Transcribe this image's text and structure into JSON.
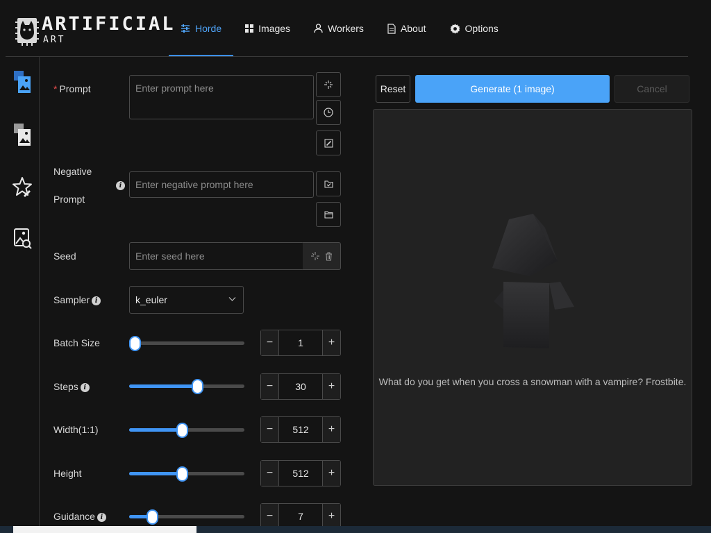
{
  "app": {
    "logo_title": "ARTIFICIAL",
    "logo_subtitle": "ART"
  },
  "nav": {
    "tabs": [
      {
        "label": "Horde",
        "icon": "sliders-icon",
        "active": true
      },
      {
        "label": "Images",
        "icon": "grid-icon",
        "active": false
      },
      {
        "label": "Workers",
        "icon": "user-icon",
        "active": false
      },
      {
        "label": "About",
        "icon": "document-icon",
        "active": false
      },
      {
        "label": "Options",
        "icon": "gear-icon",
        "active": false
      }
    ]
  },
  "sidebar": {
    "items": [
      {
        "name": "text-to-image-icon",
        "active": true
      },
      {
        "name": "image-to-image-icon",
        "active": false
      },
      {
        "name": "rating-star-icon",
        "active": false
      },
      {
        "name": "interrogate-icon",
        "active": false
      }
    ]
  },
  "form": {
    "prompt": {
      "label": "Prompt",
      "required_mark": "*",
      "placeholder": "Enter prompt here",
      "value": ""
    },
    "negative_prompt": {
      "label_line1": "Negative",
      "label_line2": "Prompt",
      "placeholder": "Enter negative prompt here",
      "value": ""
    },
    "seed": {
      "label": "Seed",
      "placeholder": "Enter seed here",
      "value": ""
    },
    "sampler": {
      "label": "Sampler",
      "value": "k_euler"
    },
    "batch_size": {
      "label": "Batch Size",
      "value": "1",
      "fraction": 0.0
    },
    "steps": {
      "label": "Steps",
      "value": "30",
      "fraction": 0.59
    },
    "width": {
      "label": "Width(1:1)",
      "value": "512",
      "fraction": 0.46
    },
    "height": {
      "label": "Height",
      "value": "512",
      "fraction": 0.46
    },
    "guidance": {
      "label": "Guidance",
      "value": "7",
      "fraction": 0.2
    },
    "info_glyph": "i",
    "minus_glyph": "−",
    "plus_glyph": "+"
  },
  "actions": {
    "reset": "Reset",
    "generate": "Generate (1 image)",
    "cancel": "Cancel"
  },
  "preview": {
    "joke": "What do you get when you cross a snowman with a vampire? Frostbite."
  },
  "colors": {
    "accent": "#4aa3f8",
    "background": "#141414",
    "panel": "#222222",
    "required": "#e84d4d"
  }
}
